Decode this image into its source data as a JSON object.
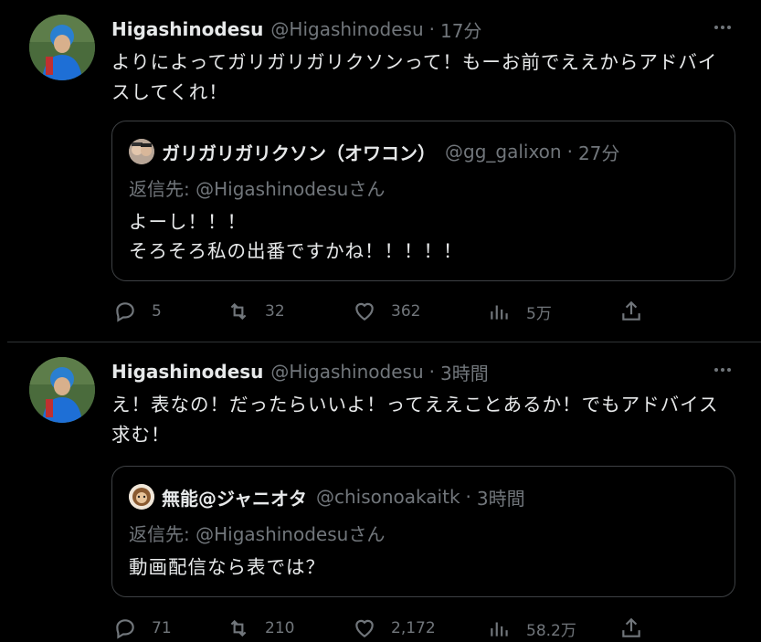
{
  "tweets": [
    {
      "display_name": "Higashinodesu",
      "handle": "@Higashinodesu",
      "time": "17分",
      "text": "よりによってガリガリガリクソンって！もーお前でええからアドバイスしてくれ！",
      "quote": {
        "display_name": "ガリガリガリクソン（オワコン）",
        "handle": "@gg_galixon",
        "time": "27分",
        "reply_prefix": "返信先: ",
        "reply_mention": "@Higashinodesuさん",
        "text_line1": "よーし！！！",
        "text_line2": "そろそろ私の出番ですかね！！！！！"
      },
      "stats": {
        "replies": "5",
        "retweets": "32",
        "likes": "362",
        "views": "5万"
      }
    },
    {
      "display_name": "Higashinodesu",
      "handle": "@Higashinodesu",
      "time": "3時間",
      "text": "え！表なの！だったらいいよ！ってええことあるか！でもアドバイス求む！",
      "quote": {
        "display_name": "無能@ジャニオタ",
        "handle": "@chisonoakaitk",
        "time": "3時間",
        "reply_prefix": "返信先: ",
        "reply_mention": "@Higashinodesuさん",
        "text_line1": "動画配信なら表では？"
      },
      "stats": {
        "replies": "71",
        "retweets": "210",
        "likes": "2,172",
        "views": "58.2万"
      }
    }
  ],
  "icons": {
    "reply": "reply-icon",
    "retweet": "retweet-icon",
    "like": "heart-icon",
    "views": "views-icon",
    "share": "share-icon",
    "more": "more-icon"
  },
  "colors": {
    "background": "#000000",
    "primary_text": "#e7e9ea",
    "secondary_text": "#71767b",
    "border": "#3e4144"
  }
}
